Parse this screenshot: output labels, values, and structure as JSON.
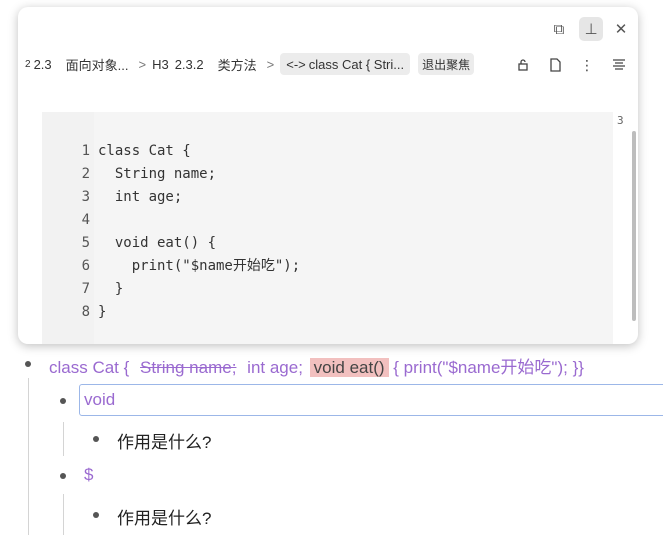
{
  "popup": {
    "controls": {
      "open_icon": "external-link-icon",
      "pin_icon": "pin-icon",
      "close_icon": "close-icon"
    },
    "breadcrumb": [
      {
        "prefix": "2",
        "text": "2.3",
        "label": "面向对象..."
      },
      {
        "prefix": "H3",
        "text": "2.3.2",
        "label": "类方法"
      },
      {
        "prefix": "<->",
        "text": "class Cat { Stri..."
      }
    ],
    "exit_focus_label": "退出聚焦",
    "toolbar_icons": [
      "unlock-icon",
      "file-icon",
      "more-icon",
      "align-icon"
    ],
    "side_number": "3",
    "code_lines": [
      {
        "n": "1",
        "t": "class Cat {"
      },
      {
        "n": "2",
        "t": "  String name;"
      },
      {
        "n": "3",
        "t": "  int age;"
      },
      {
        "n": "4",
        "t": ""
      },
      {
        "n": "5",
        "t": "  void eat() {"
      },
      {
        "n": "6",
        "t": "    print(\"$name开始吃\");"
      },
      {
        "n": "7",
        "t": "  }"
      },
      {
        "n": "8",
        "t": "}"
      }
    ]
  },
  "outline": {
    "root": {
      "part1": "class Cat {",
      "struck": "String name;",
      "part2": "int age;",
      "highlight": "void eat()",
      "part3": "{    print(\"$name开始吃\");  }}"
    },
    "child1": {
      "text": "void",
      "note": "作用是什么?"
    },
    "child2": {
      "text": "$",
      "note": "作用是什么?"
    }
  },
  "colors": {
    "reference_purple": "#9a6ad0",
    "highlight": "#f2c0bf",
    "focus_border": "#9cb7e8"
  }
}
